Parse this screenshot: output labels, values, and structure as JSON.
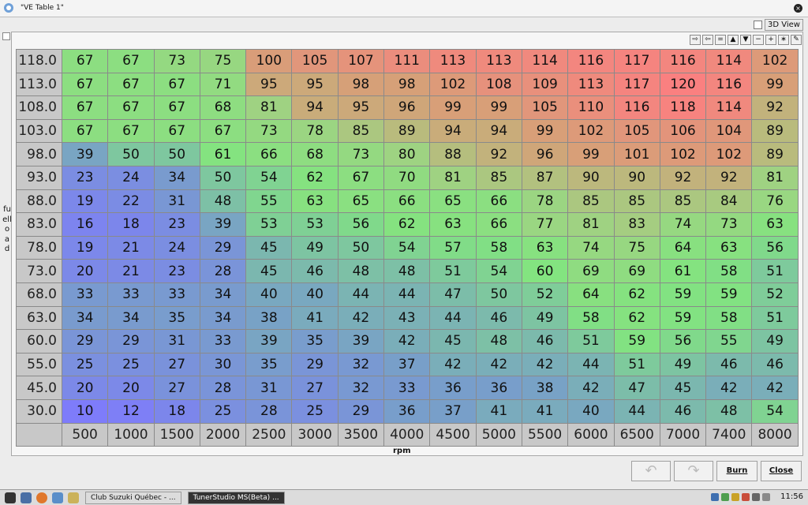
{
  "window": {
    "title": "\"VE Table 1\""
  },
  "view3d_label": "3D View",
  "toolbar": [
    "⇨",
    "⇦",
    "=",
    "▲",
    "▼",
    "−",
    "+",
    "∗",
    "✎"
  ],
  "table": {
    "y_axis_label": "fuelload",
    "x_axis_label": "rpm",
    "rows": [
      "118.0",
      "113.0",
      "108.0",
      "103.0",
      "98.0",
      "93.0",
      "88.0",
      "83.0",
      "78.0",
      "73.0",
      "68.0",
      "63.0",
      "60.0",
      "55.0",
      "45.0",
      "30.0"
    ],
    "cols": [
      "500",
      "1000",
      "1500",
      "2000",
      "2500",
      "3000",
      "3500",
      "4000",
      "4500",
      "5000",
      "5500",
      "6000",
      "6500",
      "7000",
      "7400",
      "8000"
    ],
    "values": [
      [
        67,
        67,
        73,
        75,
        100,
        105,
        107,
        111,
        113,
        113,
        114,
        116,
        117,
        116,
        114,
        102
      ],
      [
        67,
        67,
        67,
        71,
        95,
        95,
        98,
        98,
        102,
        108,
        109,
        113,
        117,
        120,
        116,
        99
      ],
      [
        67,
        67,
        67,
        68,
        81,
        94,
        95,
        96,
        99,
        99,
        105,
        110,
        116,
        118,
        114,
        92
      ],
      [
        67,
        67,
        67,
        67,
        73,
        78,
        85,
        89,
        94,
        94,
        99,
        102,
        105,
        106,
        104,
        89
      ],
      [
        39,
        50,
        50,
        61,
        66,
        68,
        73,
        80,
        88,
        92,
        96,
        99,
        101,
        102,
        102,
        89
      ],
      [
        23,
        24,
        34,
        50,
        54,
        62,
        67,
        70,
        81,
        85,
        87,
        90,
        90,
        92,
        92,
        81
      ],
      [
        19,
        22,
        31,
        48,
        55,
        63,
        65,
        66,
        65,
        66,
        78,
        85,
        85,
        85,
        84,
        76
      ],
      [
        16,
        18,
        23,
        39,
        53,
        53,
        56,
        62,
        63,
        66,
        77,
        81,
        83,
        74,
        73,
        63
      ],
      [
        19,
        21,
        24,
        29,
        45,
        49,
        50,
        54,
        57,
        58,
        63,
        74,
        75,
        64,
        63,
        56
      ],
      [
        20,
        21,
        23,
        28,
        45,
        46,
        48,
        48,
        51,
        54,
        60,
        69,
        69,
        61,
        58,
        51
      ],
      [
        33,
        33,
        33,
        34,
        40,
        40,
        44,
        44,
        47,
        50,
        52,
        64,
        62,
        59,
        59,
        52
      ],
      [
        34,
        34,
        35,
        34,
        38,
        41,
        42,
        43,
        44,
        46,
        49,
        58,
        62,
        59,
        58,
        51
      ],
      [
        29,
        29,
        31,
        33,
        39,
        35,
        39,
        42,
        45,
        48,
        46,
        51,
        59,
        56,
        55,
        49
      ],
      [
        25,
        25,
        27,
        30,
        35,
        29,
        32,
        37,
        42,
        42,
        42,
        44,
        51,
        49,
        46,
        46
      ],
      [
        20,
        20,
        27,
        28,
        31,
        27,
        32,
        33,
        36,
        36,
        38,
        42,
        47,
        45,
        42,
        42
      ],
      [
        10,
        12,
        18,
        25,
        28,
        25,
        29,
        36,
        37,
        41,
        41,
        40,
        44,
        46,
        48,
        54
      ]
    ]
  },
  "buttons": {
    "undo": "↶",
    "redo": "↷",
    "burn": "Burn",
    "close": "Close"
  },
  "taskbar": {
    "tasks": [
      "Club Suzuki Québec - ...",
      "TunerStudio MS(Beta) ..."
    ],
    "clock": "11:56"
  }
}
